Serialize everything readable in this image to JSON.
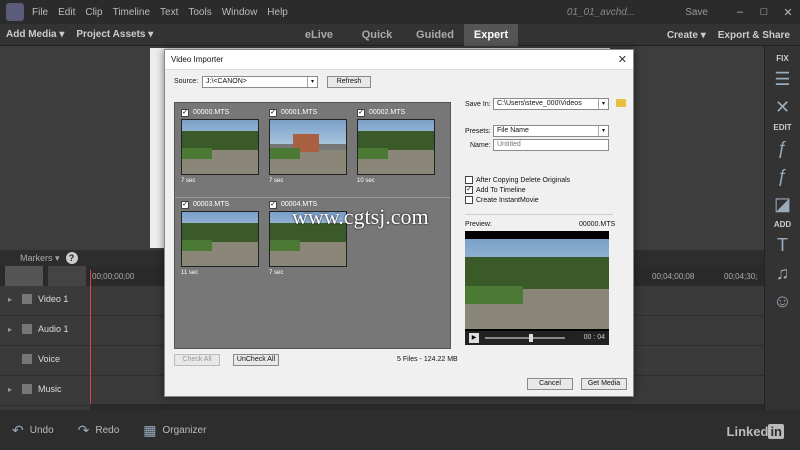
{
  "menubar": {
    "items": [
      "File",
      "Edit",
      "Clip",
      "Timeline",
      "Text",
      "Tools",
      "Window",
      "Help"
    ],
    "project_name": "01_01_avchd...",
    "save_label": "Save",
    "minimize": "–",
    "maximize": "□",
    "close": "✕"
  },
  "modebar": {
    "add_media": "Add Media ▾",
    "project_assets": "Project Assets ▾",
    "tabs": [
      "eLive",
      "Quick",
      "Guided",
      "Expert"
    ],
    "active_tab": "Expert",
    "create": "Create ▾",
    "export_share": "Export & Share"
  },
  "rightpanel": {
    "fix_label": "FIX",
    "edit_label": "EDIT",
    "add_label": "ADD"
  },
  "timeline": {
    "markers_label": "Markers ▾",
    "help_glyph": "?",
    "timecodes": [
      "00;00;00;00",
      "00;04;00;08",
      "00;04;30;"
    ],
    "tracks": [
      {
        "label": "Video 1"
      },
      {
        "label": "Audio 1"
      },
      {
        "label": "Voice"
      },
      {
        "label": "Music"
      }
    ]
  },
  "bottombar": {
    "undo": "Undo",
    "redo": "Redo",
    "organizer": "Organizer",
    "brand_text": "Linked",
    "brand_in": "in"
  },
  "dialog": {
    "title": "Video Importer",
    "close_glyph": "✕",
    "source_label": "Source:",
    "source_value": "J:\\<CANON>",
    "refresh": "Refresh",
    "clips": [
      {
        "name": "00000.MTS",
        "duration": "7 sec",
        "checked": true
      },
      {
        "name": "00001.MTS",
        "duration": "7 sec",
        "checked": true
      },
      {
        "name": "00002.MTS",
        "duration": "10 sec",
        "checked": true
      },
      {
        "name": "00003.MTS",
        "duration": "11 sec",
        "checked": true
      },
      {
        "name": "00004.MTS",
        "duration": "7 sec",
        "checked": true
      }
    ],
    "check_all": "Check All",
    "uncheck_all": "UnCheck All",
    "files_summary": "5 Files - 124.22 MB",
    "save_in_label": "Save In:",
    "save_in_value": "C:\\Users\\steve_000\\Videos",
    "presets_label": "Presets:",
    "presets_value": "File Name",
    "name_label": "Name:",
    "name_value": "Untitled",
    "options": [
      {
        "label": "After Copying Delete Originals",
        "checked": false
      },
      {
        "label": "Add To Timeline",
        "checked": true
      },
      {
        "label": "Create InstantMovie",
        "checked": false
      }
    ],
    "preview_label": "Preview:",
    "preview_file": "00000.MTS",
    "preview_time": "00 : 04",
    "cancel": "Cancel",
    "get_media": "Get Media"
  },
  "watermark": "www.cgtsj.com"
}
